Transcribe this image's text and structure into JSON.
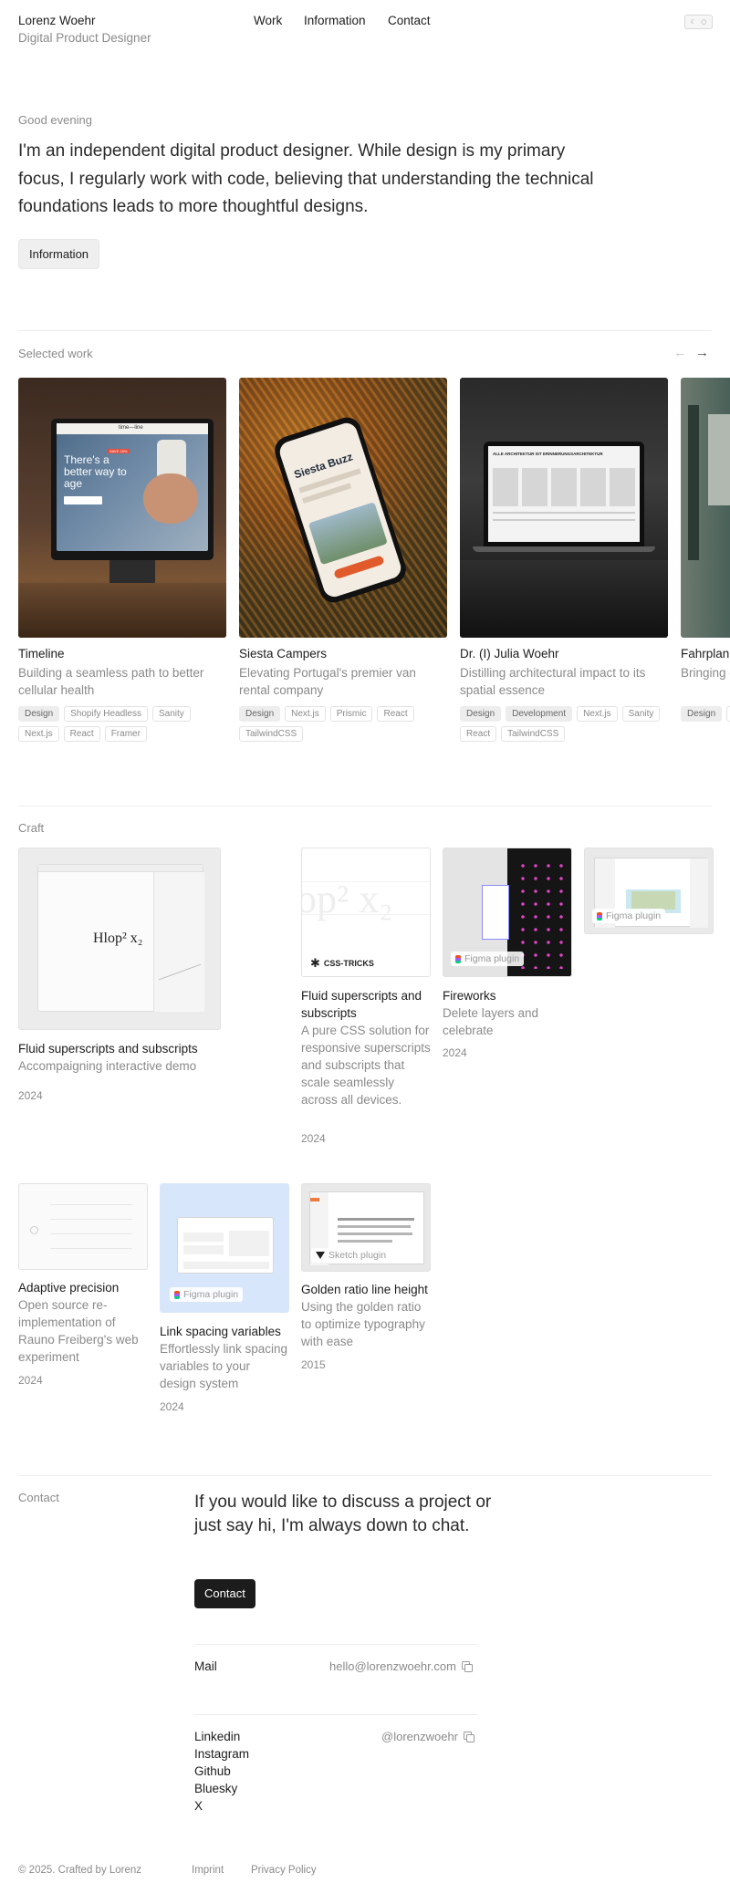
{
  "header": {
    "name": "Lorenz Woehr",
    "role": "Digital Product Designer",
    "nav": [
      "Work",
      "Information",
      "Contact"
    ],
    "theme_toggle": [
      "☾",
      "○"
    ]
  },
  "hero": {
    "greeting": "Good evening",
    "intro": "I'm an independent digital product designer. While design is my primary focus, I regularly work with code, believing that understanding the technical foundations leads to more thoughtful designs.",
    "button": "Information"
  },
  "selected_work": {
    "title": "Selected work",
    "arrows": [
      "←",
      "→"
    ],
    "items": [
      {
        "title": "Timeline",
        "description": "Building a seamless path to better cellular health",
        "tags": [
          {
            "label": "Design",
            "filled": true
          },
          {
            "label": "Shopify Headless",
            "filled": false
          },
          {
            "label": "Sanity",
            "filled": false
          },
          {
            "label": "Next.js",
            "filled": false
          },
          {
            "label": "React",
            "filled": false
          },
          {
            "label": "Framer",
            "filled": false
          }
        ],
        "thumb": {
          "headline": "There's a better way to age",
          "logo": "time—line",
          "sale": "SAVE 15%"
        }
      },
      {
        "title": "Siesta Campers",
        "description": "Elevating Portugal's premier van rental company",
        "tags": [
          {
            "label": "Design",
            "filled": true
          },
          {
            "label": "Next.js",
            "filled": false
          },
          {
            "label": "Prismic",
            "filled": false
          },
          {
            "label": "React",
            "filled": false
          },
          {
            "label": "TailwindCSS",
            "filled": false
          }
        ],
        "thumb": {
          "headline": "Siesta Buzz"
        }
      },
      {
        "title": "Dr. (I) Julia Woehr",
        "description": "Distilling architectural impact to its spatial essence",
        "tags": [
          {
            "label": "Design",
            "filled": true
          },
          {
            "label": "Development",
            "filled": true
          },
          {
            "label": "Next.js",
            "filled": false
          },
          {
            "label": "Sanity",
            "filled": false
          },
          {
            "label": "React",
            "filled": false
          },
          {
            "label": "TailwindCSS",
            "filled": false
          }
        ],
        "thumb": {
          "headline": "ALLE ARCHITEKTUR IST ERINNERUNGSARCHITEKTUR"
        }
      },
      {
        "title": "Fahrplan.",
        "description": "Bringing clarity to schedules",
        "tags": [
          {
            "label": "Design",
            "filled": true
          },
          {
            "label": "F",
            "filled": false
          }
        ]
      }
    ]
  },
  "craft": {
    "title": "Craft",
    "items": [
      {
        "title": "Fluid superscripts and subscripts",
        "description": "Accompaigning interactive demo",
        "year": "2024",
        "thumb_text": "Hlop² x₂"
      },
      {
        "title": "Fluid superscripts and subscripts",
        "description": "A pure CSS solution for responsive superscripts and subscripts that scale seamlessly across all devices.",
        "year": "2024",
        "thumb_text": "op² x₂",
        "badge": "CSS-TRICKS"
      },
      {
        "title": "Fireworks",
        "description": "Delete layers and celebrate",
        "year": "2024",
        "badge": "Figma plugin"
      },
      {
        "title": "",
        "description": "",
        "year": "",
        "badge": "Figma plugin"
      },
      {
        "title": "Adaptive precision",
        "description": "Open source re-implementation of Rauno Freiberg's web experiment",
        "year": "2024"
      },
      {
        "title": "Link spacing variables",
        "description": "Effortlessly link spacing variables to your design system",
        "year": "2024",
        "badge": "Figma plugin"
      },
      {
        "title": "Golden ratio line height",
        "description": "Using the golden ratio to optimize typography with ease",
        "year": "2015",
        "badge": "Sketch plugin"
      }
    ]
  },
  "contact": {
    "label": "Contact",
    "text": "If you would like to discuss a project or just say hi, I'm always down to chat.",
    "button": "Contact",
    "mail_label": "Mail",
    "mail_value": "hello@lorenzwoehr.com",
    "handle": "@lorenzwoehr",
    "socials": [
      "Linkedin",
      "Instagram",
      "Github",
      "Bluesky",
      "X"
    ]
  },
  "footer": {
    "copyright": "© 2025. Crafted by Lorenz",
    "links": [
      "Imprint",
      "Privacy Policy"
    ]
  },
  "colors": {
    "text": "#1c1c1c",
    "muted": "#8a8a8a",
    "divider": "#ececec",
    "button_dark": "#1c1c1c",
    "button_light": "#efefef"
  }
}
